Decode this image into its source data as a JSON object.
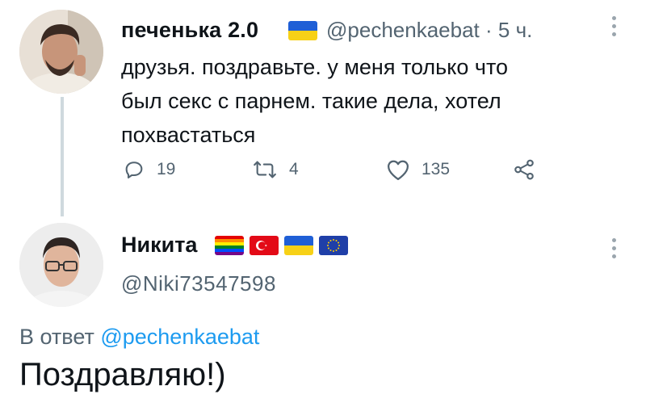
{
  "tweet": {
    "author_name": "печенька 2.0",
    "author_handle": "@pechenkaebat",
    "time": "· 5 ч.",
    "text_lines": [
      "друзья. поздравьте. у меня только что",
      "был секс с парнем. такие дела, хотел",
      "похвастаться"
    ],
    "replies": "19",
    "retweets": "4",
    "likes": "135",
    "flag_icon": "ukraine-flag"
  },
  "reply": {
    "author_name": "Никита",
    "author_handle": "@Niki73547598",
    "flags": [
      "rainbow-flag",
      "turkey-flag",
      "ukraine-flag",
      "eu-flag"
    ],
    "reply_to_prefix": "В ответ",
    "reply_to_handle": "@pechenkaebat",
    "text": "Поздравляю!)"
  },
  "colors": {
    "text": "#0f1419",
    "secondary": "#536471",
    "link": "#1d9bf0",
    "thread_line": "#cfd9de"
  }
}
